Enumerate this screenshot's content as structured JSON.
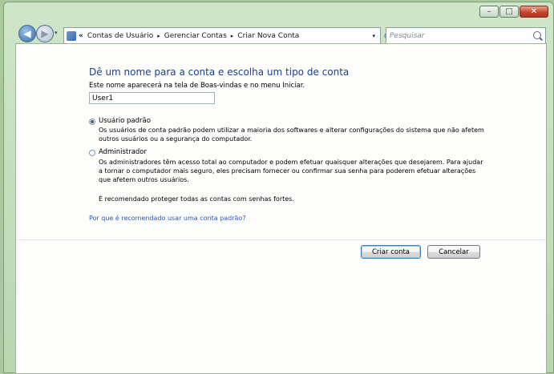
{
  "window": {
    "minimize_glyph": "–",
    "maximize_glyph": "□",
    "close_glyph": "✕"
  },
  "navbar": {
    "back_glyph": "◀",
    "forward_glyph": "▶",
    "overflow": "«",
    "breadcrumbs": [
      "Contas de Usuário",
      "Gerenciar Contas",
      "Criar Nova Conta"
    ],
    "separator": "▸",
    "dropdown_glyph": "▾",
    "refresh_glyph": "⟳",
    "search_placeholder": "Pesquisar"
  },
  "content": {
    "title": "Dê um nome para a conta e escolha um tipo de conta",
    "name_label": "Este nome aparecerá na tela de Boas-vindas e no menu Iniciar.",
    "name_value": "User1",
    "options": [
      {
        "label": "Usuário padrão",
        "selected": true,
        "desc": "Os usuários de conta padrão podem utilizar a maioria dos softwares e alterar configurações do sistema que não afetem outros usuários ou a segurança do computador."
      },
      {
        "label": "Administrador",
        "selected": false,
        "desc": "Os administradores têm acesso total ao computador e podem efetuar quaisquer alterações que desejarem. Para ajudar a tornar o computador mais seguro, eles precisam fornecer ou confirmar sua senha para poderem efetuar alterações que afetem outros usuários."
      }
    ],
    "note": "É recomendado proteger todas as contas com senhas fortes.",
    "link": "Por que é recomendado usar uma conta padrão?",
    "create_button": "Criar conta",
    "cancel_button": "Cancelar"
  }
}
